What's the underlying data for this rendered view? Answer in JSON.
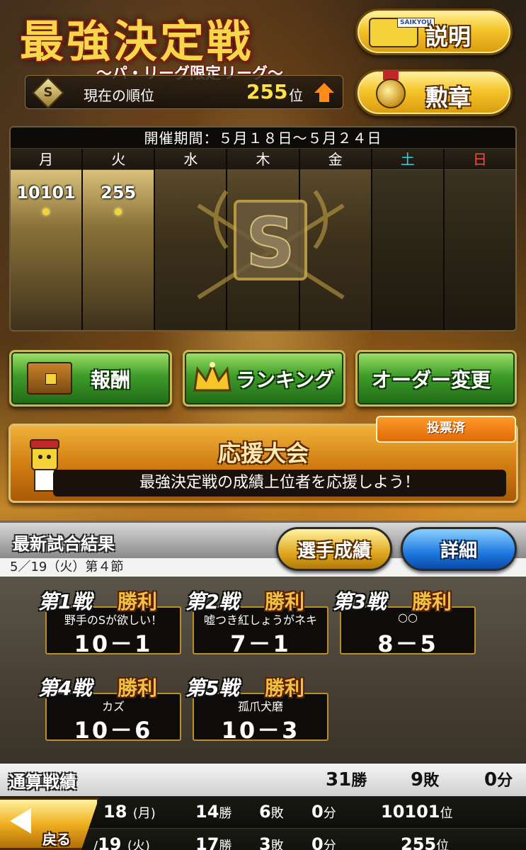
{
  "header": {
    "title": "最強決定戦",
    "subtitle": "〜パ・リーグ限定リーグ〜",
    "rank_label": "現在の順位",
    "rank_value": "255",
    "rank_unit": "位",
    "badge_letter": "S",
    "explain_button": "説明",
    "explain_tag": "SAIKYOU",
    "medal_button": "勲章"
  },
  "calendar": {
    "period": "開催期間：５月１８日〜５月２４日",
    "emblem_letter": "S",
    "days": [
      {
        "label": "月",
        "value": "10101",
        "color": "#ffffff"
      },
      {
        "label": "火",
        "value": "255",
        "color": "#ffffff"
      },
      {
        "label": "水",
        "value": "",
        "color": "#ffffff"
      },
      {
        "label": "木",
        "value": "",
        "color": "#ffffff"
      },
      {
        "label": "金",
        "value": "",
        "color": "#ffffff"
      },
      {
        "label": "土",
        "value": "",
        "color": "#3ad0e0"
      },
      {
        "label": "日",
        "value": "",
        "color": "#ff4a3a"
      }
    ]
  },
  "actions": {
    "reward": "報酬",
    "ranking": "ランキング",
    "order": "オーダー変更"
  },
  "cheer": {
    "title": "応援大会",
    "voted": "投票済",
    "message": "最強決定戦の成績上位者を応援しよう！"
  },
  "results": {
    "title": "最新試合結果",
    "round": "5／19（火）第４節",
    "player_stats_button": "選手成績",
    "detail_button": "詳細",
    "matches": [
      {
        "no": "第1戦",
        "result": "勝利",
        "opponent": "野手のSが欲しい！",
        "score": "10－1"
      },
      {
        "no": "第2戦",
        "result": "勝利",
        "opponent": "嘘つき紅しょうがネキ",
        "score": "7－1"
      },
      {
        "no": "第3戦",
        "result": "勝利",
        "opponent": "○○",
        "score": "8－5"
      },
      {
        "no": "第4戦",
        "result": "勝利",
        "opponent": "カズ",
        "score": "10－6"
      },
      {
        "no": "第5戦",
        "result": "勝利",
        "opponent": "孤爪犬磨",
        "score": "10－3"
      }
    ]
  },
  "totals": {
    "title": "通算戦績",
    "wins": "31",
    "wins_unit": "勝",
    "losses": "9",
    "losses_unit": "敗",
    "draws": "0",
    "draws_unit": "分"
  },
  "history": [
    {
      "date": "18",
      "dow": "(月)",
      "wins": "14",
      "losses": "6",
      "draws": "0",
      "rank": "10101"
    },
    {
      "date": "19",
      "dow": "(火)",
      "wins": "17",
      "losses": "3",
      "draws": "0",
      "rank": "255"
    }
  ],
  "units": {
    "win": "勝",
    "loss": "敗",
    "draw": "分",
    "rank": "位",
    "prefix": "/"
  },
  "back_button": "戻る"
}
